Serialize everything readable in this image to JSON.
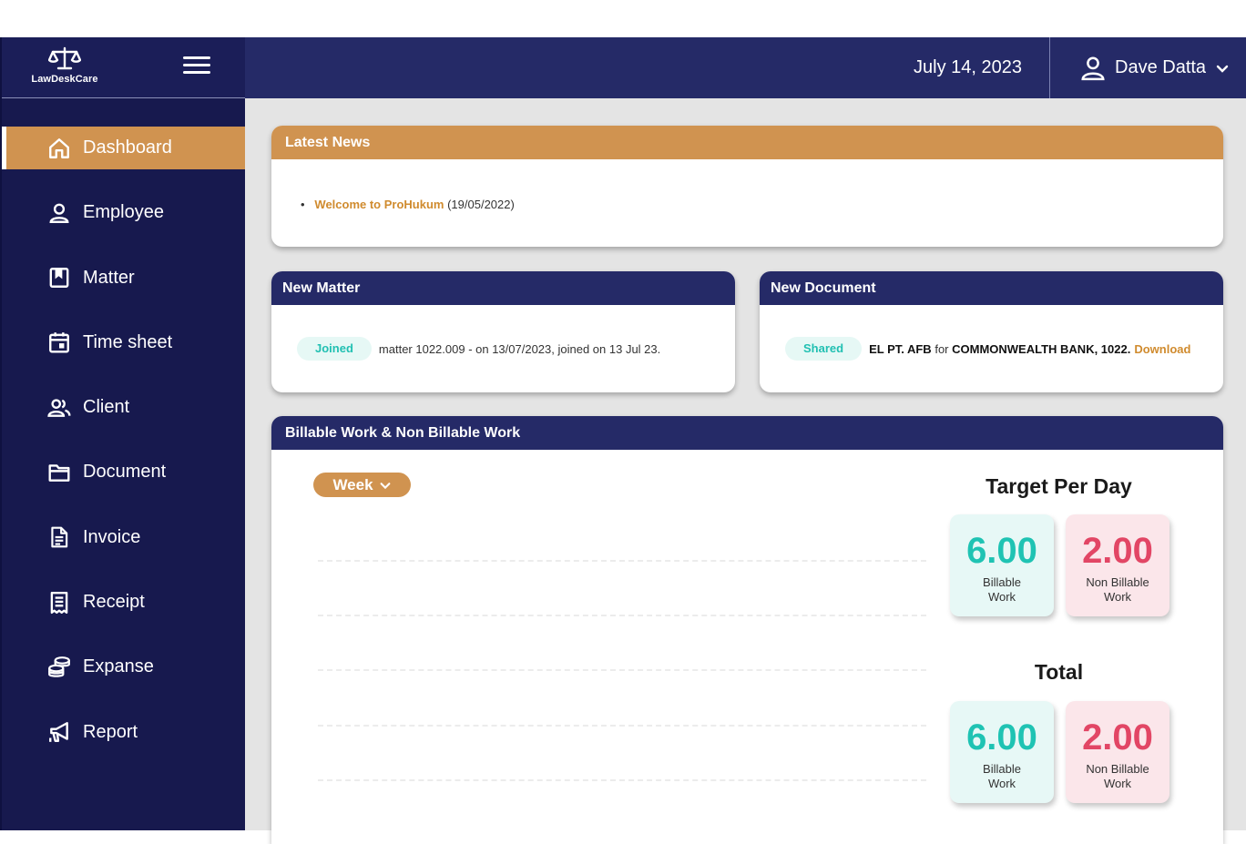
{
  "brand": {
    "name": "LawDeskCare"
  },
  "sidebar": {
    "items": [
      {
        "label": "Dashboard",
        "icon": "home-icon",
        "active": true
      },
      {
        "label": "Employee",
        "icon": "user-icon"
      },
      {
        "label": "Matter",
        "icon": "bookmark-icon"
      },
      {
        "label": "Time sheet",
        "icon": "calendar-icon"
      },
      {
        "label": "Client",
        "icon": "users-icon"
      },
      {
        "label": "Document",
        "icon": "folder-icon"
      },
      {
        "label": "Invoice",
        "icon": "file-icon"
      },
      {
        "label": "Receipt",
        "icon": "receipt-icon"
      },
      {
        "label": "Expanse",
        "icon": "coins-icon"
      },
      {
        "label": "Report",
        "icon": "megaphone-icon"
      }
    ]
  },
  "topbar": {
    "date": "July 14, 2023",
    "user_name": "Dave Datta"
  },
  "news": {
    "title": "Latest News",
    "bullet": "•",
    "item_link": "Welcome to ProHukum",
    "item_date": "(19/05/2022)"
  },
  "new_matter": {
    "title": "New Matter",
    "badge": "Joined",
    "text": "matter 1022.009 - on 13/07/2023, joined on 13 Jul 23."
  },
  "new_document": {
    "title": "New Document",
    "badge": "Shared",
    "doc_name": "EL PT. AFB",
    "for": "for",
    "client": "COMMONWEALTH BANK, 1022.",
    "download": "Download"
  },
  "billable": {
    "title": "Billable Work & Non Billable Work",
    "period": "Week",
    "target_title": "Target Per Day",
    "total_title": "Total",
    "target": {
      "billable_value": "6.00",
      "billable_label": "Billable Work",
      "non_billable_value": "2.00",
      "non_billable_label": "Non Billable Work"
    },
    "total": {
      "billable_value": "6.00",
      "billable_label": "Billable Work",
      "non_billable_value": "2.00",
      "non_billable_label": "Non Billable Work"
    }
  },
  "colors": {
    "navy": "#252a67",
    "sidebar": "#17194e",
    "accent": "#d09350",
    "teal": "#1fc3b3",
    "pink": "#e24665"
  }
}
